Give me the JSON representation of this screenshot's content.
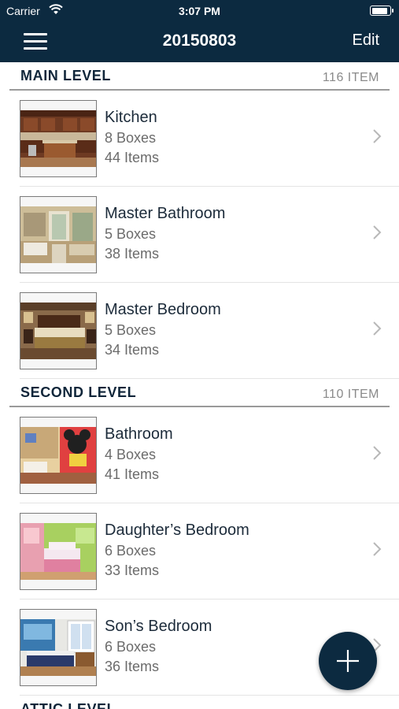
{
  "status_bar": {
    "carrier": "Carrier",
    "time": "3:07 PM",
    "battery_level": 0.95
  },
  "navbar": {
    "title": "20150803",
    "edit_label": "Edit",
    "menu_icon": "hamburger-menu-icon"
  },
  "sections": [
    {
      "title": "MAIN LEVEL",
      "count": "116 ITEM",
      "rooms": [
        {
          "name": "Kitchen",
          "boxes": "8 Boxes",
          "items": "44 Items",
          "photo": "kitchen"
        },
        {
          "name": "Master Bathroom",
          "boxes": "5 Boxes",
          "items": "38 Items",
          "photo": "bathroom"
        },
        {
          "name": "Master Bedroom",
          "boxes": "5 Boxes",
          "items": "34 Items",
          "photo": "bedroom"
        }
      ]
    },
    {
      "title": "SECOND LEVEL",
      "count": "110 ITEM",
      "rooms": [
        {
          "name": "Bathroom",
          "boxes": "4 Boxes",
          "items": "41 Items",
          "photo": "kids-bathroom"
        },
        {
          "name": "Daughter’s Bedroom",
          "boxes": "6 Boxes",
          "items": "33 Items",
          "photo": "girls-bedroom"
        },
        {
          "name": "Son’s Bedroom",
          "boxes": "6 Boxes",
          "items": "36 Items",
          "photo": "boys-bedroom"
        }
      ]
    },
    {
      "title": "ATTIC LEVEL",
      "count": "",
      "rooms": []
    }
  ],
  "fab": {
    "icon": "plus-icon"
  },
  "colors": {
    "navbar_bg": "#0c2a40",
    "fab_bg": "#0c2a40",
    "divider": "#9a9a9a"
  }
}
